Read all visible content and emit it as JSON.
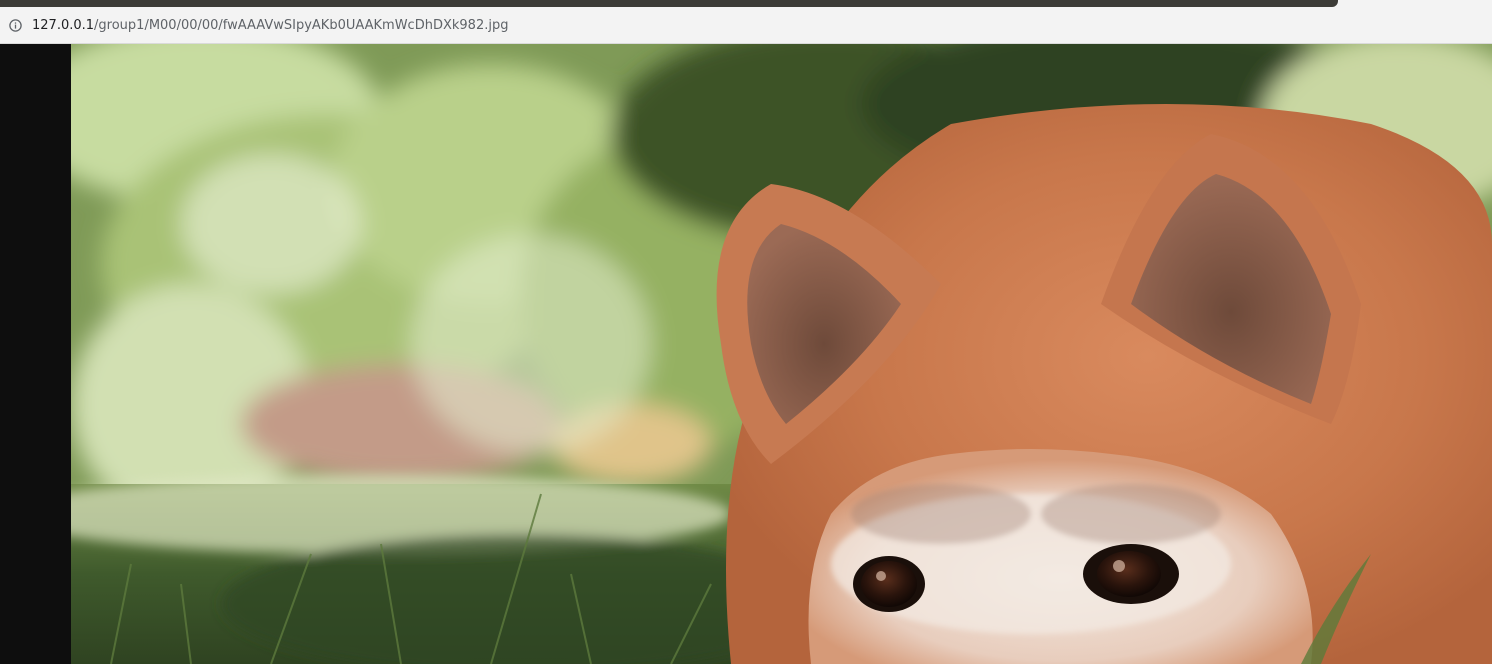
{
  "browser": {
    "address_bar": {
      "host": "127.0.0.1",
      "path": "/group1/M00/00/00/fwAAAVwSIpyAKb0UAAKmWcDhDXk982.jpg",
      "icon": "info-circle-icon"
    }
  },
  "viewer": {
    "image": {
      "subject": "",
      "icon": "image"
    }
  }
}
